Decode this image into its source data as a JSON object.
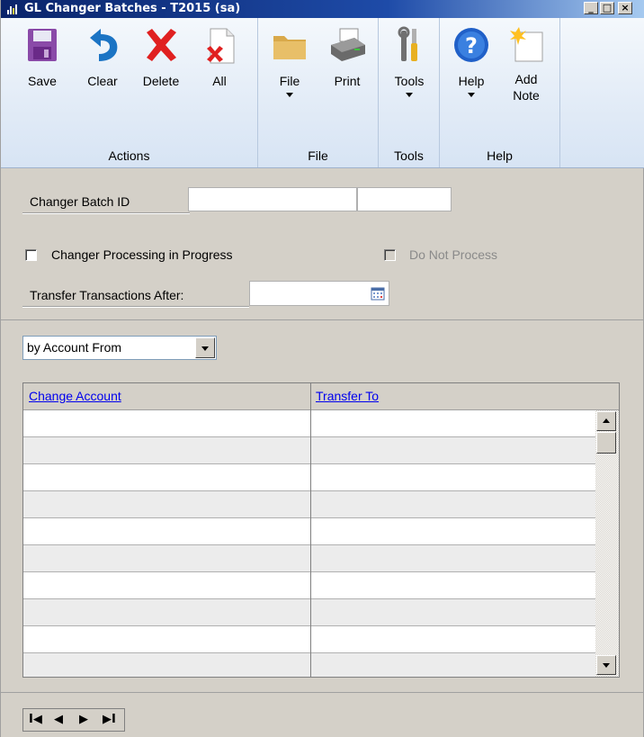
{
  "window": {
    "title": "GL Changer Batches  -  T2015 (sa)",
    "controls": {
      "minimize": "_",
      "maximize": "□",
      "close": "×"
    }
  },
  "ribbon": {
    "groups": {
      "actions": "Actions",
      "file": "File",
      "tools": "Tools",
      "help": "Help"
    },
    "buttons": {
      "save": "Save",
      "clear": "Clear",
      "delete": "Delete",
      "all": "All",
      "file": "File",
      "print": "Print",
      "tools": "Tools",
      "help": "Help",
      "add_note_1": "Add",
      "add_note_2": "Note"
    }
  },
  "form": {
    "batch_id_label": "Changer Batch ID",
    "batch_id_value": "",
    "batch_id_suffix": "",
    "processing_label": "Changer Processing in Progress",
    "processing_checked": false,
    "do_not_process_label": "Do Not Process",
    "do_not_process_checked": false,
    "transfer_after_label": "Transfer Transactions  After:",
    "transfer_after_value": ""
  },
  "grid": {
    "view_select": "by Account From",
    "columns": [
      "Change Account",
      "Transfer To"
    ],
    "rows": 10
  },
  "navigation": {
    "first": "I◀",
    "prev": "◀",
    "next": "▶",
    "last": "▶I"
  }
}
